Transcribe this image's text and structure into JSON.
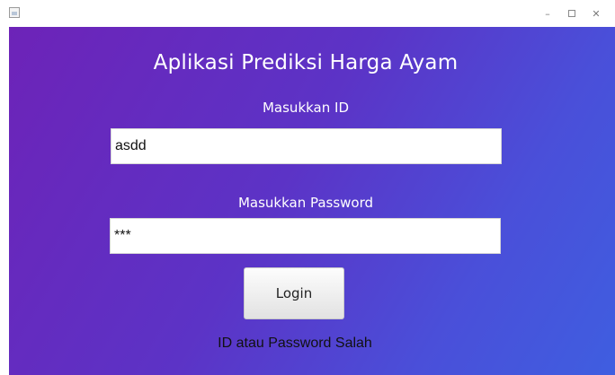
{
  "window": {
    "icon": "java-app-icon",
    "controls": {
      "minimize": "–",
      "maximize_icon": "maximize-icon",
      "close": "✕"
    }
  },
  "form": {
    "title": "Aplikasi Prediksi Harga Ayam",
    "id_label": "Masukkan ID",
    "id_value": "asdd",
    "password_label": "Masukkan Password",
    "password_value": "***",
    "login_button": "Login",
    "status_message": "ID atau Password Salah"
  },
  "colors": {
    "gradient_start": "#6d23b8",
    "gradient_end": "#3f5ee0"
  }
}
